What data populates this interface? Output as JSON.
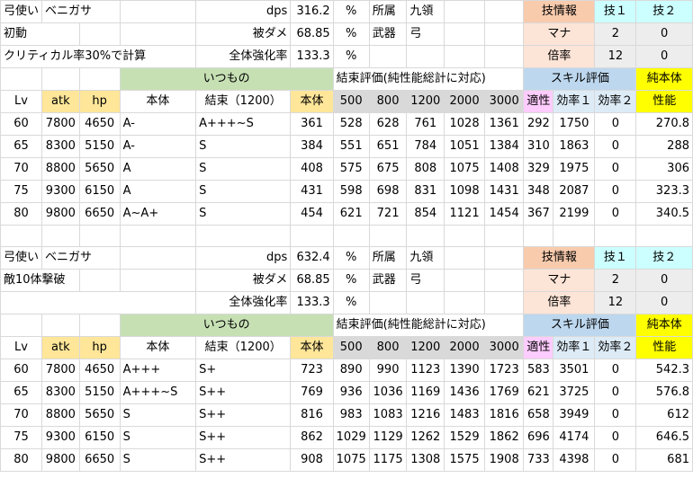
{
  "blocks": [
    {
      "info": {
        "job": "弓使い",
        "name": "ベニガサ",
        "condition": "初動",
        "crit_note": "クリティカル率30%で計算",
        "dps_label": "dps",
        "dps": "316.2",
        "dmg_label": "被ダメ",
        "dmg": "68.85",
        "boost_label": "全体強化率",
        "boost": "133.3",
        "pct": "%",
        "affil_label": "所属",
        "affil": "九領",
        "weapon_label": "武器",
        "weapon": "弓",
        "skill_info": "技情報",
        "skill1": "技１",
        "skill2": "技２",
        "mana_label": "マナ",
        "mana1": "2",
        "mana2": "0",
        "mult_label": "倍率",
        "mult1": "12",
        "mult2": "0"
      },
      "groups": {
        "usual": "いつもの",
        "bind_eval": "結束評価(純性能総計に対応)",
        "skill_eval": "スキル評価",
        "pure_top": "純本体",
        "pure_bottom": "性能"
      },
      "headers": [
        "Lv",
        "atk",
        "hp",
        "本体",
        "結束（1200）",
        "本体",
        "500",
        "800",
        "1200",
        "2000",
        "3000",
        "適性",
        "効率１",
        "効率２"
      ],
      "rows": [
        [
          "60",
          "7800",
          "4650",
          "A-",
          "A+++~S",
          "361",
          "528",
          "628",
          "761",
          "1028",
          "1361",
          "292",
          "1750",
          "0",
          "270.8"
        ],
        [
          "65",
          "8300",
          "5150",
          "A-",
          "S",
          "384",
          "551",
          "651",
          "784",
          "1051",
          "1384",
          "310",
          "1863",
          "0",
          "288"
        ],
        [
          "70",
          "8800",
          "5650",
          "A",
          "S",
          "408",
          "575",
          "675",
          "808",
          "1075",
          "1408",
          "329",
          "1975",
          "0",
          "306"
        ],
        [
          "75",
          "9300",
          "6150",
          "A",
          "S",
          "431",
          "598",
          "698",
          "831",
          "1098",
          "1431",
          "348",
          "2087",
          "0",
          "323.3"
        ],
        [
          "80",
          "9800",
          "6650",
          "A~A+",
          "S",
          "454",
          "621",
          "721",
          "854",
          "1121",
          "1454",
          "367",
          "2199",
          "0",
          "340.5"
        ]
      ]
    },
    {
      "info": {
        "job": "弓使い",
        "name": "ベニガサ",
        "condition": "敵10体撃破",
        "crit_note": "",
        "dps_label": "dps",
        "dps": "632.4",
        "dmg_label": "被ダメ",
        "dmg": "68.85",
        "boost_label": "全体強化率",
        "boost": "133.3",
        "pct": "%",
        "affil_label": "所属",
        "affil": "九領",
        "weapon_label": "武器",
        "weapon": "弓",
        "skill_info": "技情報",
        "skill1": "技１",
        "skill2": "技２",
        "mana_label": "マナ",
        "mana1": "2",
        "mana2": "0",
        "mult_label": "倍率",
        "mult1": "12",
        "mult2": "0"
      },
      "groups": {
        "usual": "いつもの",
        "bind_eval": "結束評価(純性能総計に対応)",
        "skill_eval": "スキル評価",
        "pure_top": "純本体",
        "pure_bottom": "性能"
      },
      "headers": [
        "Lv",
        "atk",
        "hp",
        "本体",
        "結束（1200）",
        "本体",
        "500",
        "800",
        "1200",
        "2000",
        "3000",
        "適性",
        "効率１",
        "効率２"
      ],
      "rows": [
        [
          "60",
          "7800",
          "4650",
          "A+++",
          "S+",
          "723",
          "890",
          "990",
          "1123",
          "1390",
          "1723",
          "583",
          "3501",
          "0",
          "542.3"
        ],
        [
          "65",
          "8300",
          "5150",
          "A+++~S",
          "S++",
          "769",
          "936",
          "1036",
          "1169",
          "1436",
          "1769",
          "621",
          "3725",
          "0",
          "576.8"
        ],
        [
          "70",
          "8800",
          "5650",
          "S",
          "S++",
          "816",
          "983",
          "1083",
          "1216",
          "1483",
          "1816",
          "658",
          "3949",
          "0",
          "612"
        ],
        [
          "75",
          "9300",
          "6150",
          "S",
          "S++",
          "862",
          "1029",
          "1129",
          "1262",
          "1529",
          "1862",
          "696",
          "4174",
          "0",
          "646.5"
        ],
        [
          "80",
          "9800",
          "6650",
          "S",
          "S++",
          "908",
          "1075",
          "1175",
          "1308",
          "1575",
          "1908",
          "733",
          "4398",
          "0",
          "681"
        ]
      ]
    }
  ]
}
